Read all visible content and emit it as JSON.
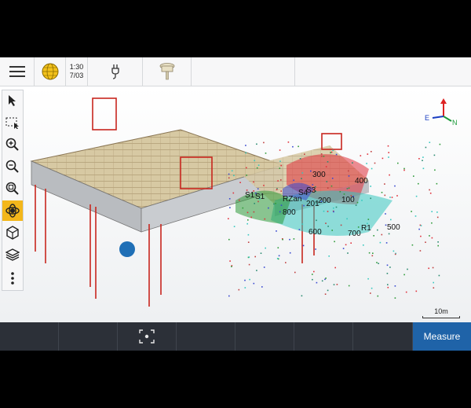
{
  "topbar": {
    "time_line1": "1:30",
    "time_line2": "7/03",
    "icons": [
      "menu-icon",
      "globe-icon",
      "plug-icon",
      "gps-receiver-icon"
    ]
  },
  "toolbar": {
    "tools": [
      "select-arrow-icon",
      "box-select-icon",
      "zoom-in-icon",
      "zoom-out-icon",
      "zoom-extents-icon",
      "orbit-icon",
      "cube-view-icon",
      "layers-icon",
      "more-vertical-icon"
    ],
    "active_tool": "orbit-icon",
    "active_color": "#f3b71b"
  },
  "axes": {
    "x": "E",
    "y": "N"
  },
  "scene_labels": {
    "s1": "S1",
    "s1b": "S1",
    "s3": "S3",
    "s4": "S4",
    "n300": "300",
    "n400": "400",
    "n100": "100",
    "n800": "800",
    "n600": "600",
    "n700": "700",
    "r1": "R1",
    "n500": "500",
    "n200": "200",
    "n201": "201",
    "raden": "RZan"
  },
  "scale_label": "10m",
  "bottombar": {
    "measure_label": "Measure",
    "icons": [
      "focus-target-icon"
    ]
  },
  "colors": {
    "accent": "#1f63a8",
    "bottom_bar": "#2c3038",
    "cursor_dot": "#1f6fb6"
  }
}
